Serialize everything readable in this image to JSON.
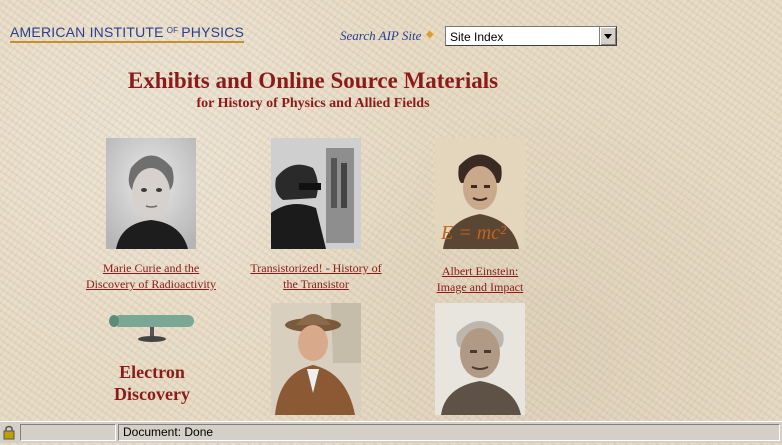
{
  "header": {
    "logo_left": "AMERICAN INSTITUTE",
    "logo_of": "OF",
    "logo_right": "PHYSICS",
    "search_label": "Search AIP Site",
    "select_value": "Site Index"
  },
  "main": {
    "title": "Exhibits and Online Source Materials",
    "subtitle": "for History of Physics and Allied Fields",
    "exhibits": [
      {
        "line1": "Marie Curie and the",
        "line2": "Discovery of Radioactivity"
      },
      {
        "line1": "Transistorized! - History of",
        "line2": "the Transistor"
      },
      {
        "line1": "Albert Einstein:",
        "line2": "Image and Impact"
      },
      {
        "image_text_line1": "Electron",
        "image_text_line2": "Discovery"
      },
      {},
      {}
    ],
    "einstein_formula": "E = mc²"
  },
  "statusbar": {
    "status_text": "Document: Done"
  }
}
